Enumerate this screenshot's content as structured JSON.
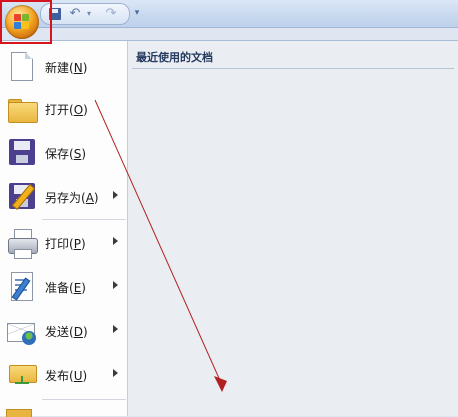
{
  "quick_access": {
    "save_icon": "save-icon",
    "undo_icon": "undo-icon",
    "redo_icon": "redo-icon",
    "customize_glyph": "▾"
  },
  "office_button": {
    "icon": "office-logo-icon",
    "highlight_color": "#d4161c"
  },
  "menu": {
    "items": [
      {
        "label": "新建",
        "key": "N",
        "icon": "new-document-icon",
        "has_submenu": false
      },
      {
        "label": "打开",
        "key": "O",
        "icon": "open-folder-icon",
        "has_submenu": false
      },
      {
        "label": "保存",
        "key": "S",
        "icon": "save-floppy-icon",
        "has_submenu": false
      },
      {
        "label": "另存为",
        "key": "A",
        "icon": "save-as-icon",
        "has_submenu": true
      },
      {
        "label": "打印",
        "key": "P",
        "icon": "printer-icon",
        "has_submenu": true
      },
      {
        "label": "准备",
        "key": "E",
        "icon": "prepare-document-icon",
        "has_submenu": true
      },
      {
        "label": "发送",
        "key": "D",
        "icon": "send-envelope-icon",
        "has_submenu": true
      },
      {
        "label": "发布",
        "key": "U",
        "icon": "publish-icon",
        "has_submenu": true
      }
    ]
  },
  "recent_documents": {
    "title": "最近使用的文档"
  },
  "annotation": {
    "arrow_color": "#b02020"
  }
}
